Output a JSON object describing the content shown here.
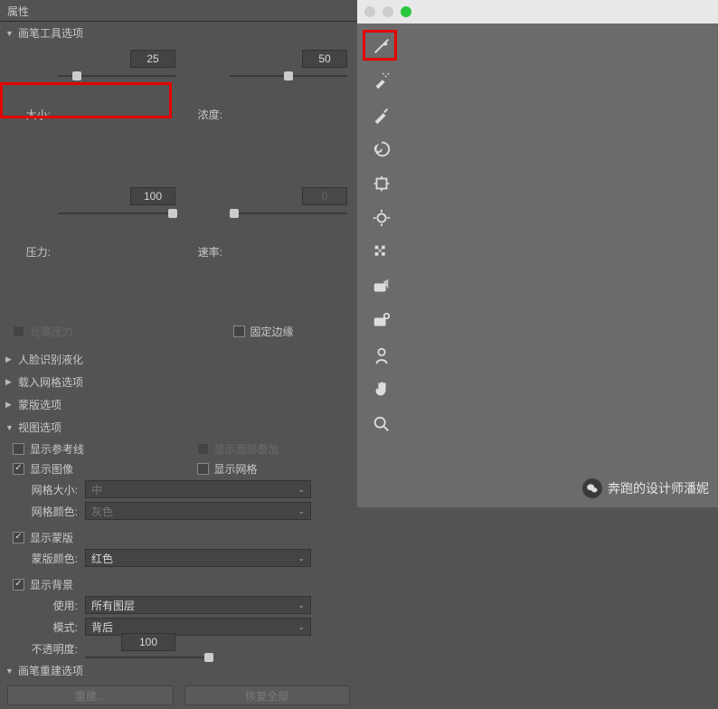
{
  "panel": {
    "title": "属性"
  },
  "brush": {
    "header": "画笔工具选项",
    "size_label": "大小:",
    "size_value": "25",
    "density_label": "浓度:",
    "density_value": "50",
    "pressure_label": "压力:",
    "pressure_value": "100",
    "rate_label": "速率:",
    "rate_value": "0",
    "pen_pressure": "光笔压力",
    "fixed_edge": "固定边缘"
  },
  "sections": {
    "face": "人脸识别液化",
    "loadmesh": "载入网格选项",
    "mask": "蒙版选项",
    "view": "视图选项",
    "reconstruct": "画笔重建选项"
  },
  "view": {
    "show_guides": "显示参考线",
    "show_face_overlay": "显示面部叠加",
    "show_image": "显示图像",
    "show_mesh": "显示网格",
    "mesh_size_label": "网格大小:",
    "mesh_size_value": "中",
    "mesh_color_label": "网格颜色:",
    "mesh_color_value": "灰色",
    "show_mask": "显示蒙版",
    "mask_color_label": "蒙版颜色:",
    "mask_color_value": "红色",
    "show_bg": "显示背景",
    "use_label": "使用:",
    "use_value": "所有图层",
    "mode_label": "模式:",
    "mode_value": "背后",
    "opacity_label": "不透明度:",
    "opacity_value": "100"
  },
  "buttons": {
    "reconstruct": "重建...",
    "restore_all": "恢复全部"
  },
  "watermark": {
    "text": "奔跑的设计师潘妮"
  },
  "colors": {
    "red": "#e60000",
    "green_dot": "#28c840"
  }
}
